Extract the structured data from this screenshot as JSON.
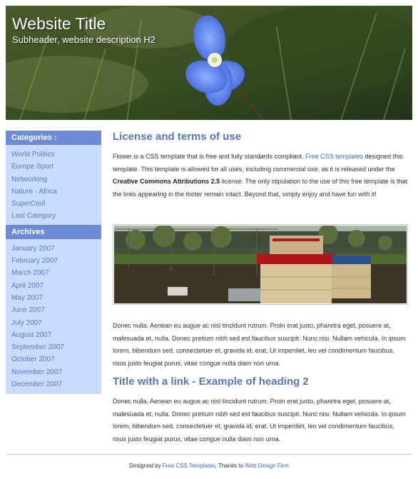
{
  "header": {
    "title": "Website Title",
    "subtitle": "Subheader, website description H2"
  },
  "sidebar": {
    "categories_heading": "Categories :",
    "categories": [
      "World Politics",
      "Europe Sport",
      "Networking",
      "Nature - Africa",
      "SuperCool",
      "Last Category"
    ],
    "archives_heading": "Archives",
    "archives": [
      "January 2007",
      "February 2007",
      "March 2007",
      "April 2007",
      "May 2007",
      "June 2007",
      "July 2007",
      "August 2007",
      "September 2007",
      "October 2007",
      "November 2007",
      "December 2007"
    ]
  },
  "main": {
    "heading1": "License and terms of use",
    "intro": {
      "t1": "Flower is a CSS template that is free and fully standards compliant. ",
      "link": "Free CSS templates",
      "t2": " designed this template. This template is allowed for all uses, including commercial use, as it is released under the ",
      "bold": "Creative Commons Attributions 2.5",
      "t3": " license. The only stipulation to the use of this free template is that the links appearing in the footer remain intact. Beyond that, simply enjoy and have fun with it!"
    },
    "para1": "Donec nulla. Aenean eu augue ac nisl tincidunt rutrum. Proin erat justo, pharetra eget, posuere at, malesuada et, nulla. Donec pretium nibh sed est faucibus suscipit. Nunc nisi. Nullam vehicula. In ipsum lorem, bibendum sed, consectetuer et, gravida id, erat. Ut imperdiet, leo vel condimentum faucibus, risus justo feugiat purus, vitae congue nulla diam non urna.",
    "heading2": "Title with a link - Example of heading 2",
    "para2": "Donec nulla. Aenean eu augue ac nisl tincidunt rutrum. Proin erat justo, pharetra eget, posuere at, malesuada et, nulla. Donec pretium nibh sed est faucibus suscipit. Nunc nisi. Nullam vehicula. In ipsum lorem, bibendum sed, consectetuer et, gravida id, erat. Ut imperdiet, leo vel condimentum faucibus, risus justo feugiat purus, vitae congue nulla diam non urna."
  },
  "footer": {
    "prefix": "Designed by ",
    "link1": "Free CSS Templates",
    "middle": ", Thanks to ",
    "link2": "Web Design Firm"
  },
  "colors": {
    "accent": "#5577c0",
    "sidebar_bg": "#c9dbff",
    "sidebar_head_bg": "#6d8cd6",
    "link": "#5a7ac9"
  }
}
